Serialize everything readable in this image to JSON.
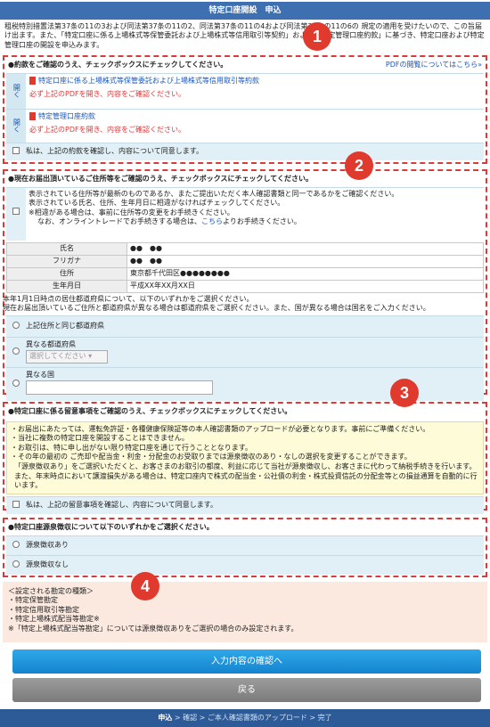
{
  "header": {
    "title": "特定口座開設　申込"
  },
  "intro": "租税特別措置法第37条の11の3および同法第37条の11の2、同法第37条の11の4および同法第37条の11の6の 規定の適用を受けたいので、この旨届け出ます。また、「特定口座に係る上場株式等保管委託および上場株式等信用取引等契約」および「特定管理口座約款」に基づき、特定口座および特定管理口座の開設を申込みます。",
  "sec1": {
    "title": "●約款をご確認のうえ、チェックボックスにチェックしてください。",
    "link": "PDFの閲覧についてはこちら»",
    "open1": "開く",
    "pdf1": "特定口座に係る上場株式等保管委託および上場株式等信用取引等約款",
    "note1": "必ず上記のPDFを開き、内容をご確認ください。",
    "open2": "開く",
    "pdf2": "特定管理口座約款",
    "note2": "必ず上記のPDFを開き、内容をご確認ください。",
    "agree": "私は、上記の約款を確認し、内容について同意します。"
  },
  "sec2": {
    "title": "●現在お届出頂いているご住所等をご確認のうえ、チェックボックスにチェックしてください。",
    "l1": "表示されている住所等が最新のものであるか、またご提出いただく本人確認書類と同一であるかをご確認ください。",
    "l2": "表示されている氏名、住所、生年月日に相違がなければチェックしてください。",
    "l3": "※相違がある場合は、事前に住所等の変更をお手続きください。",
    "l4a": "なお、オンライントレードでお手続きする場合は、",
    "l4link": "こちら",
    "l4b": "よりお手続きください。",
    "rows": [
      {
        "k": "氏名",
        "v": "●●　●●"
      },
      {
        "k": "フリガナ",
        "v": "●●　●●"
      },
      {
        "k": "住所",
        "v": "東京都千代田区●●●●●●●●"
      },
      {
        "k": "生年月日",
        "v": "平成XX年XX月XX日"
      }
    ],
    "ask1": "本年1月1日時点の居住都道府県について、以下のいずれかをご選択ください。",
    "ask2": "現在お届出頂いているご住所と都道府県が異なる場合は都道府県をご選択ください。また、国が異なる場合は国名をご入力ください。",
    "opt1": "上記住所と同じ都道府県",
    "opt2": "異なる都道府県",
    "select_placeholder": "選択してください",
    "opt3": "異なる国"
  },
  "sec3": {
    "title": "●特定口座に係る留意事項をご確認のうえ、チェックボックスにチェックしてください。",
    "n1": "・お届出にあたっては、運転免許証・各種健康保険証等の本人確認書類のアップロードが必要となります。事前にご準備ください。",
    "n2": "・当社に複数の特定口座を開設することはできません。",
    "n3": "・お取引は、特に申し出がない限り特定口座を通じて行うこととなります。",
    "n4": "・その年の最初の ご売却や配当金・利金・分配金のお受取りまでは源泉徴収のあり・なしの選択を変更することができます。",
    "n5": "「源泉徴収あり」をご選択いただくと、お客さまのお取引の都度、利益に応じて当社が源泉徴収し、お客さまに代わって納税手続きを行います。",
    "n6": "また、年末時点において譲渡損失がある場合は、特定口座内で株式の配当金・公社債の利金・株式投資信託の分配金等との損益通算を自動的に行います。",
    "agree": "私は、上記の留意事項を確認し、内容について同意します。"
  },
  "sec4": {
    "title": "●特定口座源泉徴収について以下のいずれかをご選択ください。",
    "opt1": "源泉徴収あり",
    "opt2": "源泉徴収なし"
  },
  "settings": {
    "l1": "＜設定される勘定の種類＞",
    "l2": "・特定保管勘定",
    "l3": "・特定信用取引等勘定",
    "l4": "・特定上場株式配当等勘定※",
    "l5": "※「特定上場株式配当等勘定」については源泉徴収ありをご選択の場合のみ設定されます。"
  },
  "buttons": {
    "confirm": "入力内容の確認へ",
    "back": "戻る"
  },
  "footer": {
    "current": "申込",
    "rest": " > 確認 > ご本人確認書類のアップロード > 完了"
  },
  "badges": [
    "1",
    "2",
    "3",
    "4"
  ],
  "colors": {
    "header": "#3e6fb0",
    "dash": "#d93a3a",
    "badge": "#e0392e",
    "button": "#1384cf"
  }
}
